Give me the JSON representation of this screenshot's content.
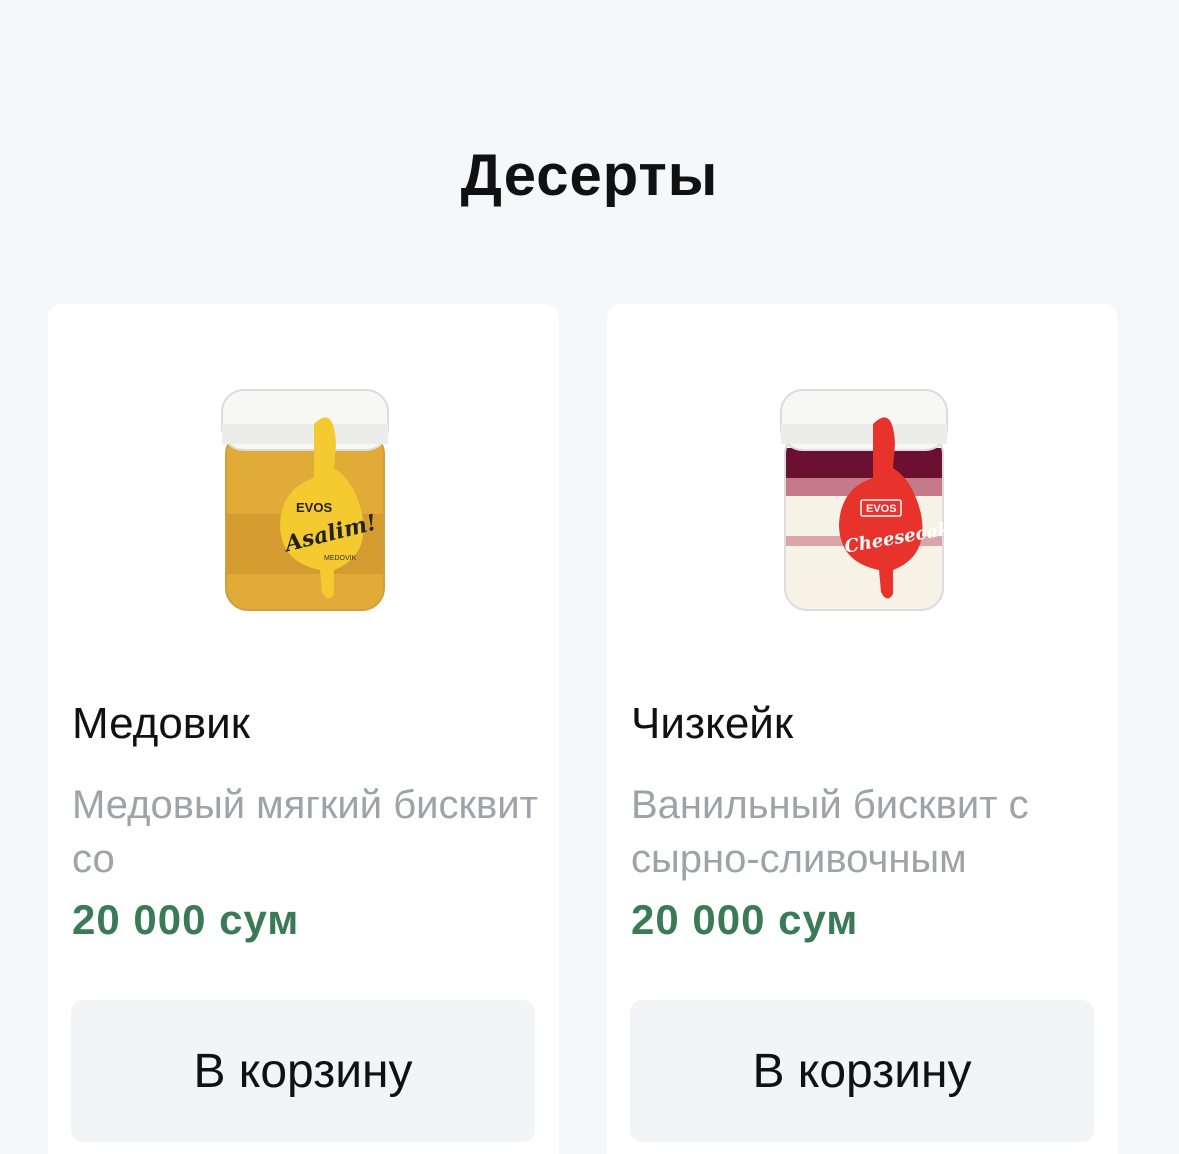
{
  "section": {
    "title": "Десерты"
  },
  "products": [
    {
      "name": "Медовик",
      "description": "Медовый мягкий бисквит со",
      "price": "20 000 сум",
      "button_label": "В корзину",
      "jar": {
        "brand": "EVOS",
        "label_text": "Asalim!",
        "sub_text": "MEDOVIK",
        "accent": "#f5c930",
        "filling": "#e1ab38"
      }
    },
    {
      "name": "Чизкейк",
      "description": "Ванильный бисквит с сырно-сливочным",
      "price": "20 000 сум",
      "button_label": "В корзину",
      "jar": {
        "brand": "EVOS",
        "label_text": "Cheesecake",
        "accent": "#e8322c",
        "filling": "#f6f2e6"
      }
    }
  ]
}
